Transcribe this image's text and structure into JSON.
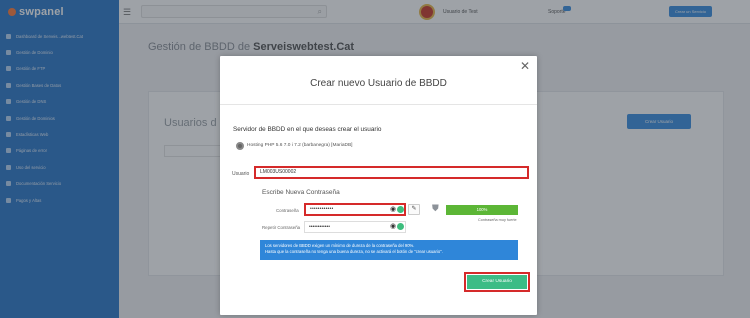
{
  "app": {
    "logo_text": "swpanel"
  },
  "sidebar": {
    "items": [
      {
        "label": "Dashboard de Serveis...webtest.Cat"
      },
      {
        "label": "Gestión de Dominio"
      },
      {
        "label": "Gestión de FTP"
      },
      {
        "label": "Gestión Bases de Datos"
      },
      {
        "label": "Gestión de DNS"
      },
      {
        "label": "Gestión de Dominios"
      },
      {
        "label": "Estadísticas Web"
      },
      {
        "label": "Páginas de error"
      },
      {
        "label": "Uso del servicio"
      },
      {
        "label": "Documentación Servicio"
      },
      {
        "label": "Pagos y Altas"
      }
    ]
  },
  "topbar": {
    "user_name": "Usuario de Test",
    "support_label": "Soporte",
    "top_button": "Crear un Servicio"
  },
  "page": {
    "title_prefix": "Gestión de BBDD de ",
    "title_domain": "Serveiswebtest.Cat",
    "panel_title": "Usuarios d",
    "panel_button": "Crear Usuario"
  },
  "modal": {
    "title": "Crear nuevo Usuario de BBDD",
    "server_question": "Servidor de BBDD en el que deseas crear el usuario",
    "server_option": "Hosting PHP 5.6 7.0 i 7.2 (barbanegra) [MariaDB]",
    "usuario_label": "Usuario",
    "usuario_value": "LM003US00002",
    "new_password_title": "Escribe Nueva Contraseña",
    "password_label": "Contraseña",
    "password_value": "••••••••••••",
    "repeat_label": "Repetir Contraseña",
    "repeat_value": "••••••••••••",
    "strength_text": "100%",
    "strength_percent": 100,
    "strength_label": "Contraseña muy fuerte",
    "info_line1": "Los servidores de BBDD exigen un mínimo de dureza de la contraseña del 90%.",
    "info_line2": "Hasta que la contraseña no tenga una buena dureza, no se activará el botón de \"crear usuario\".",
    "create_button": "Crear Usuario",
    "close_symbol": "✕"
  },
  "colors": {
    "sidebar": "#2c78c9",
    "accent_blue": "#3b8fe0",
    "highlight_red": "#d52a2a",
    "success_green": "#3cbc86",
    "strength_green": "#5cb636"
  },
  "icons": [
    "menu-icon",
    "search-icon",
    "eye-icon",
    "check-icon",
    "pencil-icon",
    "shield-icon",
    "close-icon",
    "radio-icon"
  ]
}
